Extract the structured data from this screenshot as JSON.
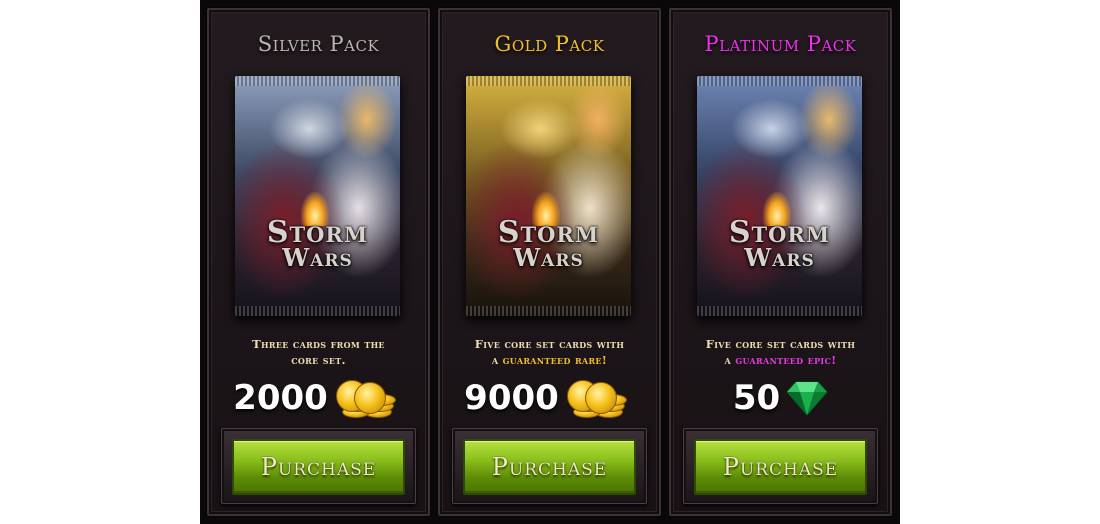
{
  "packs": [
    {
      "title": "Silver Pack",
      "logo_line1": "Storm",
      "logo_line2": "Wars",
      "desc_a": "Three cards from the",
      "desc_b": "core set.",
      "price": "2000",
      "currency_icon": "gold-coins-icon",
      "button": "Purchase",
      "title_color": "#b9b6b4"
    },
    {
      "title": "Gold Pack",
      "logo_line1": "Storm",
      "logo_line2": "Wars",
      "desc_a": "Five core set cards with",
      "desc_b_prefix": "a",
      "desc_highlight": "guaranteed rare",
      "desc_suffix": "!",
      "price": "9000",
      "currency_icon": "gold-coins-icon",
      "button": "Purchase",
      "title_color": "#f2c12a"
    },
    {
      "title": "Platinum Pack",
      "logo_line1": "Storm",
      "logo_line2": "Wars",
      "desc_a": "Five core set cards with",
      "desc_b_prefix": "a",
      "desc_highlight": "guaranteed epic",
      "desc_suffix": "!",
      "price": "50",
      "currency_icon": "emerald-gem-icon",
      "button": "Purchase",
      "title_color": "#ee2fee"
    }
  ],
  "colors": {
    "button_green": "#8cc11c",
    "panel_bg": "#1c1519",
    "rare_highlight": "#f4bd2a",
    "epic_highlight": "#e43ae4",
    "desc_text": "#eedfb2"
  }
}
